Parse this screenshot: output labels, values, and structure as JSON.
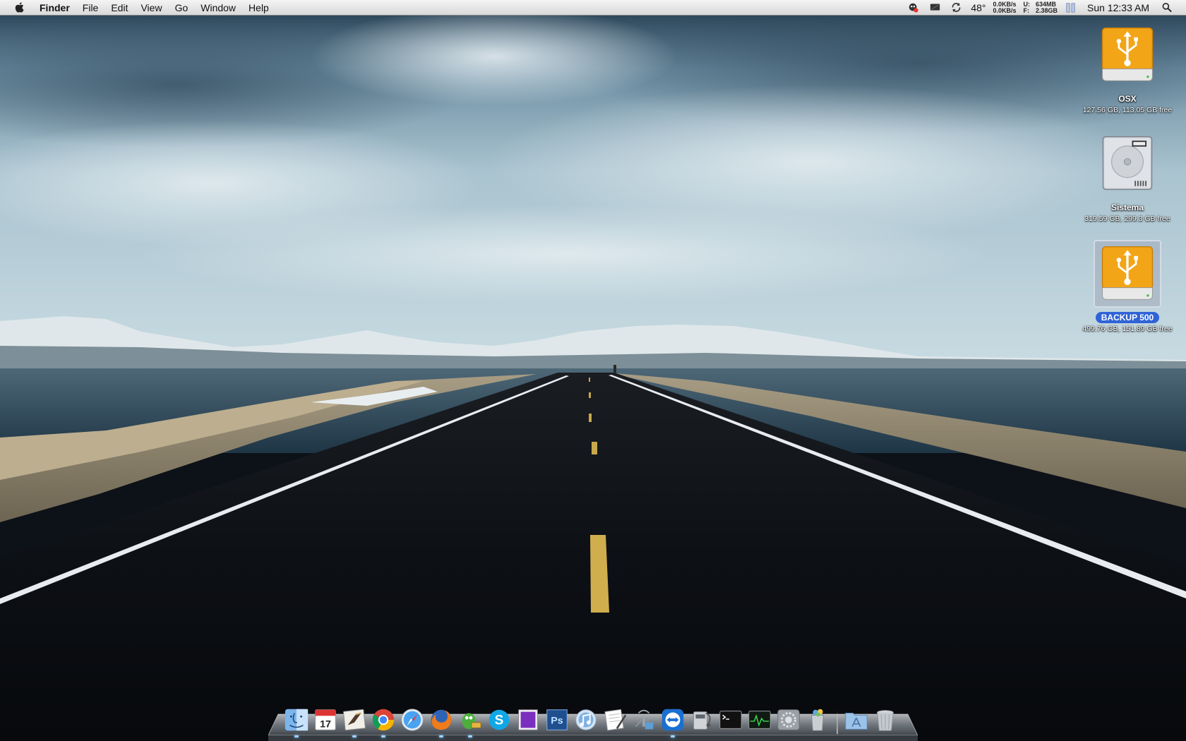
{
  "menubar": {
    "apple_icon": "apple-logo-icon",
    "app_name": "Finder",
    "menus": [
      "File",
      "Edit",
      "View",
      "Go",
      "Window",
      "Help"
    ],
    "status": {
      "temperature": "48°",
      "net_down": "0.0KB/s",
      "net_up": "0.0KB/s",
      "mem_used_label": "U:",
      "mem_free_label": "F:",
      "mem_used": "634MB",
      "mem_free": "2.38GB",
      "clock": "Sun 12:33 AM"
    }
  },
  "desktop_icons": [
    {
      "name": "OSX",
      "info": "127.56 GB, 113.05 GB free",
      "type": "usb-drive-icon",
      "selected": false
    },
    {
      "name": "Sistema",
      "info": "319.59 GB, 299.3 GB free",
      "type": "hard-drive-icon",
      "selected": false
    },
    {
      "name": "BACKUP 500",
      "info": "499.76 GB, 151.89 GB free",
      "type": "usb-drive-icon",
      "selected": true
    }
  ],
  "dock": {
    "apps": [
      "finder-icon",
      "ical-icon",
      "mail-icon",
      "chrome-icon",
      "safari-icon",
      "firefox-icon",
      "adium-icon",
      "skype-icon",
      "preview-icon",
      "photoshop-icon",
      "itunes-icon",
      "textedit-icon",
      "network-utility-icon",
      "teamviewer-icon",
      "system-profiler-icon",
      "terminal-icon",
      "activity-monitor-icon",
      "system-preferences-icon",
      "recycle-icon"
    ],
    "stacks": [
      "applications-folder-icon",
      "trash-icon"
    ],
    "photoshop_label": "Ps",
    "calendar_day": "17"
  },
  "colors": {
    "menubar_bg": "#e6e6e6",
    "selection_blue": "#2f63d6",
    "usb_orange": "#f2a516"
  }
}
